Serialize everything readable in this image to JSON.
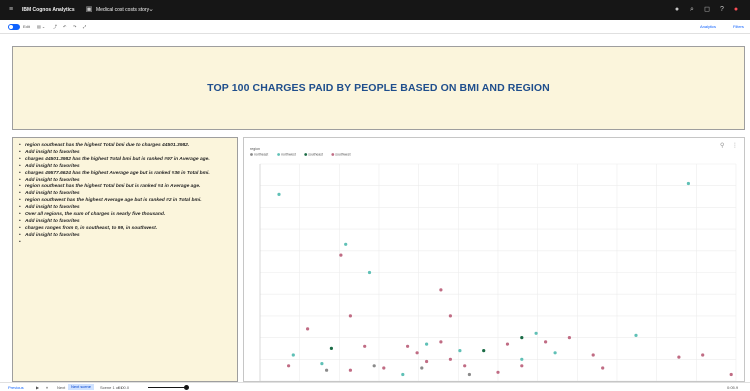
{
  "topbar": {
    "app_title": "IBM Cognos Analytics",
    "report_name": "Medical cost costs story",
    "icons": [
      "menu-icon",
      "report-icon",
      "chevron-down-icon",
      "avatar",
      "search-icon",
      "chat-icon",
      "help-icon",
      "notification-icon",
      "user-icon"
    ]
  },
  "toolbar": {
    "edit_label": "Edit",
    "analytics_label": "Analytics",
    "filters_label": "Filters"
  },
  "title_panel": {
    "text": "TOP 100 CHARGES PAID BY PEOPLE BASED ON BMI AND REGION"
  },
  "insights": [
    "region southeast has the highest Total bmi due to charges 44501.3982.",
    "Add insight to favorites",
    "charges 44501.3982 has the highest Total bmi but is ranked #97 in Average age.",
    "Add insight to favorites",
    "charges 49577.6624 has the highest Average age but is ranked #36 in Total bmi.",
    "Add insight to favorites",
    "region southeast has the highest Total bmi but is ranked #4 in Average age.",
    "Add insight to favorites",
    "region southwest has the highest Average age but is ranked #2 in Total bmi.",
    "Add insight to favorites",
    "Over all regions, the sum of charges is nearly five thousand.",
    "Add insight to favorites",
    "charges ranges from 0, in southeast, to 99, in southwest.",
    "Add insight to favorites",
    ""
  ],
  "chart_data": {
    "type": "scatter",
    "title": "",
    "legend_title": "region",
    "legend_position": "top-left",
    "grid": true,
    "xlim": [
      0,
      1
    ],
    "ylim": [
      0,
      1
    ],
    "series": [
      {
        "name": "northeast",
        "color": "#8a8a8a",
        "points": [
          [
            0.14,
            0.05
          ],
          [
            0.24,
            0.07
          ],
          [
            0.34,
            0.06
          ],
          [
            0.44,
            0.03
          ]
        ]
      },
      {
        "name": "northwest",
        "color": "#5fc0b6",
        "points": [
          [
            0.04,
            0.86
          ],
          [
            0.18,
            0.63
          ],
          [
            0.23,
            0.5
          ],
          [
            0.07,
            0.12
          ],
          [
            0.13,
            0.08
          ],
          [
            0.3,
            0.03
          ],
          [
            0.35,
            0.17
          ],
          [
            0.42,
            0.14
          ],
          [
            0.58,
            0.22
          ],
          [
            0.62,
            0.13
          ],
          [
            0.79,
            0.21
          ],
          [
            0.55,
            0.1
          ],
          [
            0.9,
            0.91
          ]
        ]
      },
      {
        "name": "southeast",
        "color": "#1a6b45",
        "points": [
          [
            0.15,
            0.15
          ],
          [
            0.47,
            0.14
          ],
          [
            0.55,
            0.2
          ]
        ]
      },
      {
        "name": "southwest",
        "color": "#c06c84",
        "points": [
          [
            0.1,
            0.24
          ],
          [
            0.19,
            0.3
          ],
          [
            0.38,
            0.42
          ],
          [
            0.31,
            0.16
          ],
          [
            0.38,
            0.18
          ],
          [
            0.4,
            0.1
          ],
          [
            0.43,
            0.07
          ],
          [
            0.26,
            0.06
          ],
          [
            0.19,
            0.05
          ],
          [
            0.35,
            0.09
          ],
          [
            0.52,
            0.17
          ],
          [
            0.6,
            0.18
          ],
          [
            0.5,
            0.04
          ],
          [
            0.55,
            0.07
          ],
          [
            0.7,
            0.12
          ],
          [
            0.88,
            0.11
          ],
          [
            0.93,
            0.12
          ],
          [
            0.99,
            0.03
          ],
          [
            0.06,
            0.07
          ],
          [
            0.22,
            0.16
          ],
          [
            0.4,
            0.3
          ],
          [
            0.33,
            0.13
          ],
          [
            0.65,
            0.2
          ],
          [
            0.72,
            0.06
          ],
          [
            0.17,
            0.58
          ]
        ]
      }
    ]
  },
  "chart_panel": {
    "icons": [
      "pin-icon",
      "more-options-icon"
    ]
  },
  "statusbar": {
    "previous": "Previous",
    "next": "Next",
    "fit_label": "Next scene",
    "scene_label": "Scene 1 of 1",
    "time_label": "0:00.0",
    "end_time": "0:05.9"
  }
}
